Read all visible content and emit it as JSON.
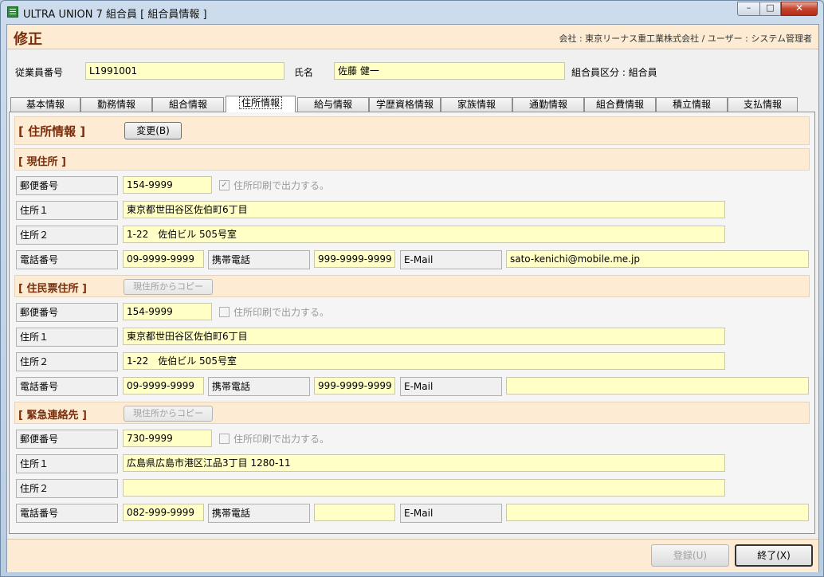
{
  "window": {
    "title": "ULTRA UNION 7 組合員 [ 組合員情報 ]",
    "min": "–",
    "max": "□",
    "close": "✕"
  },
  "header": {
    "mode": "修正",
    "company": "会社 : 東京リーナス重工業株式会社 / ユーザー : システム管理者"
  },
  "employee": {
    "id_label": "従業員番号",
    "id_value": "L1991001",
    "name_label": "氏名",
    "name_value": "佐藤 健一",
    "kubun": "組合員区分 : 組合員"
  },
  "tabs": [
    "基本情報",
    "勤務情報",
    "組合情報",
    "住所情報",
    "給与情報",
    "学歴資格情報",
    "家族情報",
    "通勤情報",
    "組合費情報",
    "積立情報",
    "支払情報"
  ],
  "panel": {
    "title": "[ 住所情報 ]",
    "change_button": "変更(B)"
  },
  "labels": {
    "postal": "郵便番号",
    "address1": "住所１",
    "address2": "住所２",
    "phone": "電話番号",
    "mobile": "携帯電話",
    "email": "E-Mail",
    "print_option": "住所印刷で出力する。",
    "copy_button": "現住所からコピー"
  },
  "sections": {
    "current": {
      "title": "[ 現住所 ]",
      "postal": "154-9999",
      "print_checked": true,
      "address1": "東京都世田谷区佐伯町6丁目",
      "address2": "1-22　佐伯ビル 505号室",
      "phone": "09-9999-9999",
      "mobile": "999-9999-9999",
      "email": "sato-kenichi@mobile.me.jp"
    },
    "resident": {
      "title": "[ 住民票住所 ]",
      "postal": "154-9999",
      "print_checked": false,
      "address1": "東京都世田谷区佐伯町6丁目",
      "address2": "1-22　佐伯ビル 505号室",
      "phone": "09-9999-9999",
      "mobile": "999-9999-9999",
      "email": ""
    },
    "emergency": {
      "title": "[ 緊急連絡先 ]",
      "postal": "730-9999",
      "print_checked": false,
      "address1": "広島県広島市港区江品3丁目 1280-11",
      "address2": "",
      "phone": "082-999-9999",
      "mobile": "",
      "email": ""
    }
  },
  "footer": {
    "register_button": "登録(U)",
    "exit_button": "終了(X)"
  }
}
